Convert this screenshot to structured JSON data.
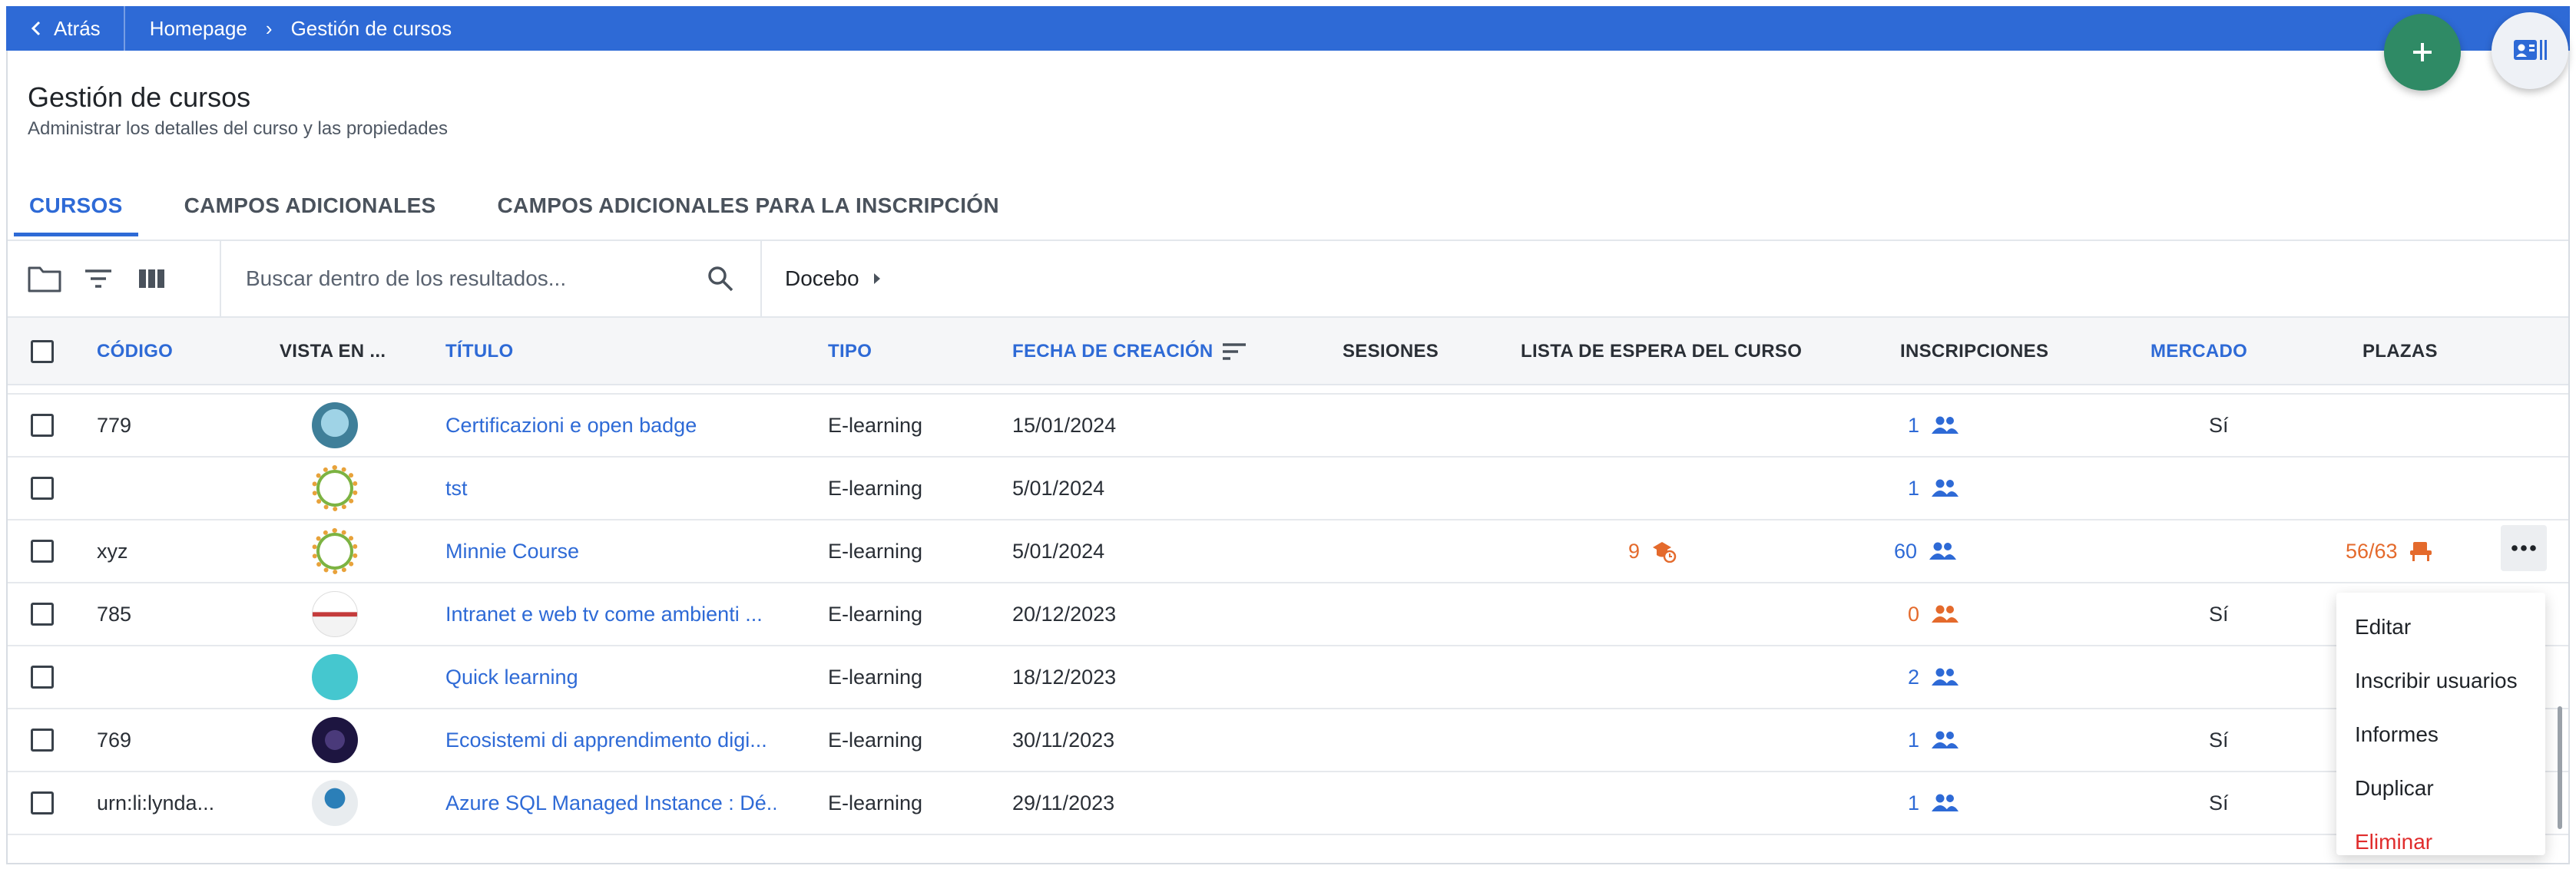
{
  "nav": {
    "back_label": "Atrás",
    "breadcrumb": [
      "Homepage",
      "Gestión de cursos"
    ]
  },
  "page": {
    "title": "Gestión de cursos",
    "subtitle": "Administrar los detalles del curso y las propiedades"
  },
  "tabs": [
    {
      "label": "CURSOS",
      "active": true
    },
    {
      "label": "CAMPOS ADICIONALES",
      "active": false
    },
    {
      "label": "CAMPOS ADICIONALES PARA LA INSCRIPCIÓN",
      "active": false
    }
  ],
  "toolbar": {
    "search_placeholder": "Buscar dentro de los resultados...",
    "catalog_label": "Docebo",
    "icons": [
      "folder-icon",
      "filter-icon",
      "columns-icon",
      "search-icon",
      "chevron-right-icon"
    ]
  },
  "table": {
    "columns": [
      "CÓDIGO",
      "VISTA EN ...",
      "TÍTULO",
      "TIPO",
      "FECHA DE CREACIÓN",
      "SESIONES",
      "LISTA DE ESPERA DEL CURSO",
      "INSCRIPCIONES",
      "MERCADO",
      "PLAZAS"
    ],
    "rows": [
      {
        "code": "779",
        "title": "Certificazioni e open badge",
        "type": "E-learning",
        "date": "15/01/2024",
        "waitlist": "",
        "enrollments": "1",
        "enroll_color": "blue",
        "market": "Sí",
        "seats": "",
        "thumb": "blue"
      },
      {
        "code": "",
        "title": "tst",
        "type": "E-learning",
        "date": "5/01/2024",
        "waitlist": "",
        "enrollments": "1",
        "enroll_color": "blue",
        "market": "",
        "seats": "",
        "thumb": "ring"
      },
      {
        "code": "xyz",
        "title": "Minnie Course",
        "type": "E-learning",
        "date": "5/01/2024",
        "waitlist": "9",
        "enrollments": "60",
        "enroll_color": "blue",
        "market": "",
        "seats": "56/63",
        "thumb": "ring"
      },
      {
        "code": "785",
        "title": "Intranet e web tv come ambienti ...",
        "type": "E-learning",
        "date": "20/12/2023",
        "waitlist": "",
        "enrollments": "0",
        "enroll_color": "orange",
        "market": "Sí",
        "seats": "",
        "thumb": "white"
      },
      {
        "code": "",
        "title": "Quick learning",
        "type": "E-learning",
        "date": "18/12/2023",
        "waitlist": "",
        "enrollments": "2",
        "enroll_color": "blue",
        "market": "",
        "seats": "",
        "thumb": "teal"
      },
      {
        "code": "769",
        "title": "Ecosistemi di apprendimento digi...",
        "type": "E-learning",
        "date": "30/11/2023",
        "waitlist": "",
        "enrollments": "1",
        "enroll_color": "blue",
        "market": "Sí",
        "seats": "",
        "thumb": "dark"
      },
      {
        "code": "urn:li:lynda...",
        "title": "Azure SQL Managed Instance : Dé...",
        "type": "E-learning",
        "date": "29/11/2023",
        "waitlist": "",
        "enrollments": "1",
        "enroll_color": "blue",
        "market": "Sí",
        "seats": "",
        "thumb": "gray"
      }
    ]
  },
  "context_menu": {
    "items": [
      "Editar",
      "Inscribir usuarios",
      "Informes",
      "Duplicar",
      "Eliminar"
    ]
  },
  "colors": {
    "brand": "#2e6ad6",
    "fab_add": "#2f8a65",
    "warning": "#e46a2c",
    "danger": "#e02c2c"
  }
}
